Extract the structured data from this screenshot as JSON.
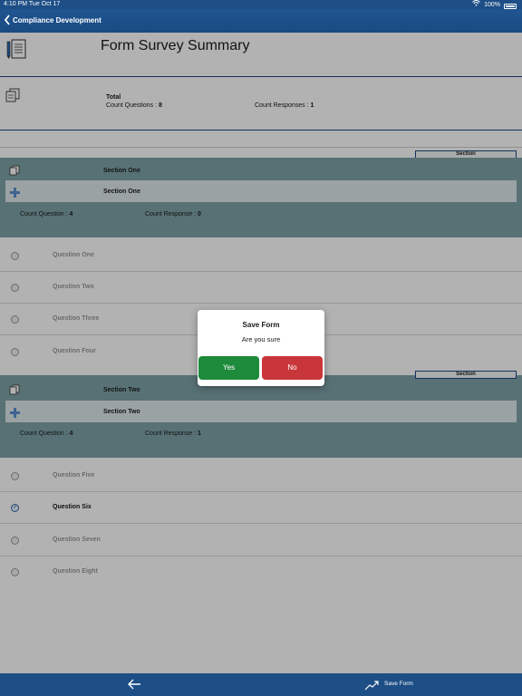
{
  "status_bar": {
    "time": "4:10 PM",
    "date": "Tue Oct 17",
    "battery": "100%"
  },
  "nav": {
    "title": "Compliance Development"
  },
  "summary": {
    "title": "Form Survey Summary",
    "total_label": "Total",
    "count_questions_label": "Count Questions :",
    "count_questions_value": "8",
    "count_responses_label": "Count Responses :",
    "count_responses_value": "1"
  },
  "sections": [
    {
      "tag": "Section",
      "name": "Section One",
      "inner_name": "Section One",
      "count_question_label": "Count Question :",
      "count_question_value": "4",
      "count_response_label": "Count Response :",
      "count_response_value": "0",
      "questions": [
        {
          "label": "Question One",
          "checked": false
        },
        {
          "label": "Question Two",
          "checked": false
        },
        {
          "label": "Question Three",
          "checked": false
        },
        {
          "label": "Question Four",
          "checked": false
        }
      ]
    },
    {
      "tag": "Section",
      "name": "Section Two",
      "inner_name": "Section Two",
      "count_question_label": "Count Question :",
      "count_question_value": "4",
      "count_response_label": "Count Response :",
      "count_response_value": "1",
      "questions": [
        {
          "label": "Question Five",
          "checked": false
        },
        {
          "label": "Question Six",
          "checked": true
        },
        {
          "label": "Question Seven",
          "checked": false
        },
        {
          "label": "Question Eight",
          "checked": false
        }
      ]
    }
  ],
  "dialog": {
    "title": "Save Form",
    "message": "Are you sure",
    "yes_label": "Yes",
    "no_label": "No",
    "yes_color": "#1e8a3c",
    "no_color": "#c9363a"
  },
  "bottom_bar": {
    "back_icon": "arrow-left-icon",
    "save_icon": "trend-up-icon",
    "save_label": "Save Form"
  },
  "colors": {
    "primary": "#1d4e86",
    "section_background": "#7fa3a8",
    "section_inner": "#dfe9eb"
  }
}
